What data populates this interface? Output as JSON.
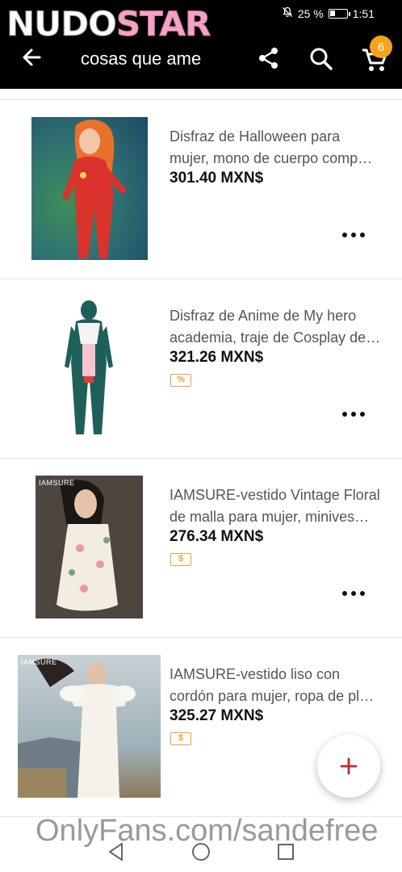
{
  "watermark": {
    "logo_part1": "NUDO",
    "logo_part2": "STAR",
    "footer": "OnlyFans.com/sandefree"
  },
  "status_bar": {
    "battery": "25 %",
    "time": "1:51"
  },
  "header": {
    "title": "cosas que ame",
    "cart_count": "6"
  },
  "items": [
    {
      "title_line1": "Disfraz de Halloween para",
      "title_line2": "mujer, mono de cuerpo comp…",
      "price": "301.40 MXN$",
      "badge": ""
    },
    {
      "title_line1": "Disfraz de Anime de My hero",
      "title_line2": "academia, traje de Cosplay de…",
      "price": "321.26 MXN$",
      "badge": "%"
    },
    {
      "title_line1": "IAMSURE-vestido Vintage Floral",
      "title_line2": "de malla para mujer, minives…",
      "price": "276.34 MXN$",
      "badge": "$",
      "image_text": "IAMSURE"
    },
    {
      "title_line1": "IAMSURE-vestido liso con",
      "title_line2": "cordón para mujer, ropa de pl…",
      "price": "325.27 MXN$",
      "badge": "$",
      "image_text": "IAMSURE"
    }
  ],
  "colors": {
    "header_bg": "#000000",
    "badge_orange": "#f7a21b",
    "coupon_border": "#e8a23b",
    "fab_plus": "#c62828"
  },
  "icons": [
    "back-arrow-icon",
    "share-icon",
    "search-icon",
    "cart-icon",
    "more-icon",
    "plus-icon",
    "nav-back-icon",
    "nav-home-icon",
    "nav-recents-icon"
  ]
}
